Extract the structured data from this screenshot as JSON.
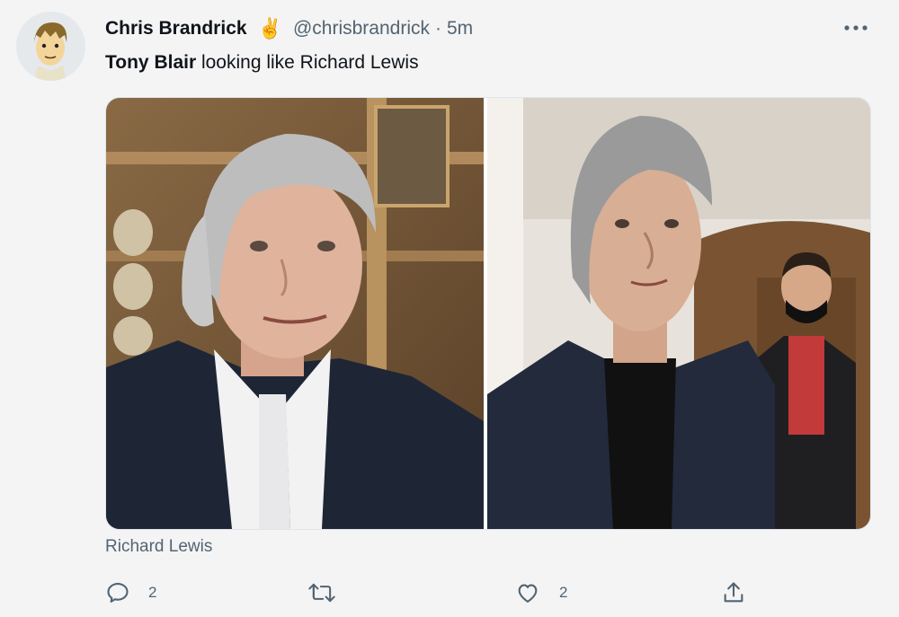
{
  "author": {
    "display_name": "Chris Brandrick",
    "emoji": "✌️",
    "handle": "@chrisbrandrick",
    "separator": "·",
    "time": "5m"
  },
  "tweet": {
    "mention": "Tony Blair",
    "text": " looking like Richard Lewis"
  },
  "media": {
    "caption": "Richard Lewis",
    "left_photo_icon": "portrait-photo",
    "right_photo_icon": "portrait-photo"
  },
  "actions": {
    "reply_count": "2",
    "retweet_count": "",
    "like_count": "2"
  },
  "colors": {
    "text": "#0f1419",
    "secondary": "#536471",
    "background": "#f4f4f5"
  }
}
